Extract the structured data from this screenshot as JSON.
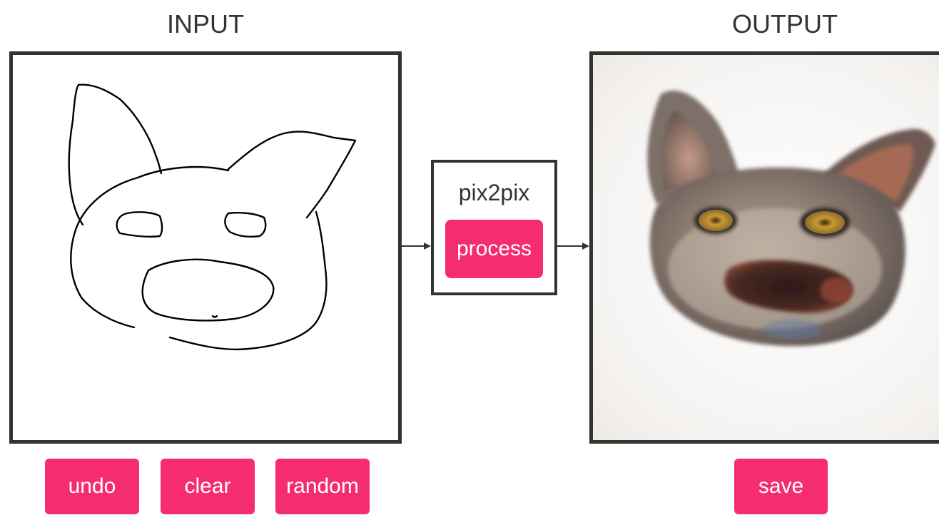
{
  "input_panel": {
    "title": "INPUT"
  },
  "output_panel": {
    "title": "OUTPUT"
  },
  "model": {
    "name": "pix2pix",
    "process_label": "process"
  },
  "controls": {
    "undo_label": "undo",
    "clear_label": "clear",
    "random_label": "random",
    "save_label": "save"
  },
  "colors": {
    "accent": "#f52c6e",
    "frame": "#333333",
    "text": "#333333",
    "background": "#ffffff"
  },
  "icons": {
    "arrow_in": "arrow-right-icon",
    "arrow_out": "arrow-right-icon"
  }
}
